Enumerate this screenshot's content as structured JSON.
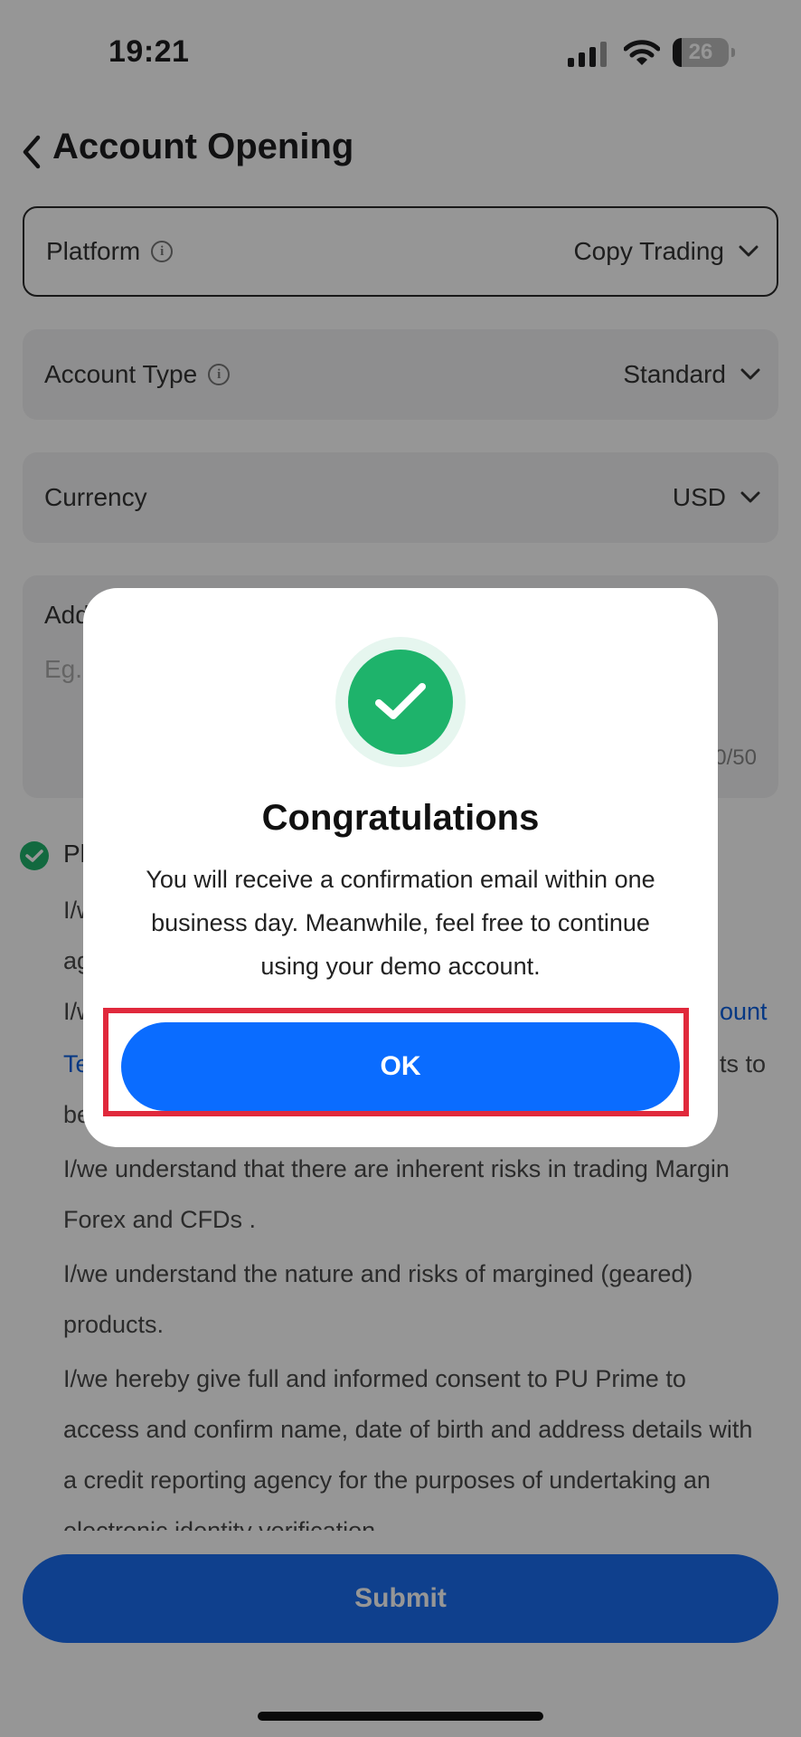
{
  "status_bar": {
    "time": "19:21",
    "battery": "26"
  },
  "header": {
    "title": "Account Opening"
  },
  "form": {
    "platform": {
      "label": "Platform",
      "value": "Copy Trading"
    },
    "account_type": {
      "label": "Account Type",
      "value": "Standard"
    },
    "currency": {
      "label": "Currency",
      "value": "USD"
    },
    "additional": {
      "label": "Add",
      "placeholder": "Eg.",
      "counter": "0/50"
    }
  },
  "terms": {
    "heading": "Pl",
    "line1_a": "I/w",
    "line1_b": "ag",
    "line2_a": "I/w",
    "line2_link_end": "ount",
    "line3_link": "Te",
    "line3_end": "ts to",
    "line4": "be",
    "para1": "I/we understand that there are inherent risks in trading Margin Forex and CFDs .",
    "para2": "I/we understand the nature and risks of margined (geared) products.",
    "para3": "I/we hereby give full and informed consent to PU Prime to access and confirm name, date of birth and address details with a credit reporting agency for the purposes of undertaking an electronic identity verification"
  },
  "submit_label": "Submit",
  "modal": {
    "title": "Congratulations",
    "message": "You will receive a confirmation email within one business day.  Meanwhile, feel free to continue using your demo account.",
    "ok_label": "OK"
  },
  "colors": {
    "primary": "#0a6cff",
    "success": "#1eb36b",
    "highlight": "#e0293c"
  }
}
